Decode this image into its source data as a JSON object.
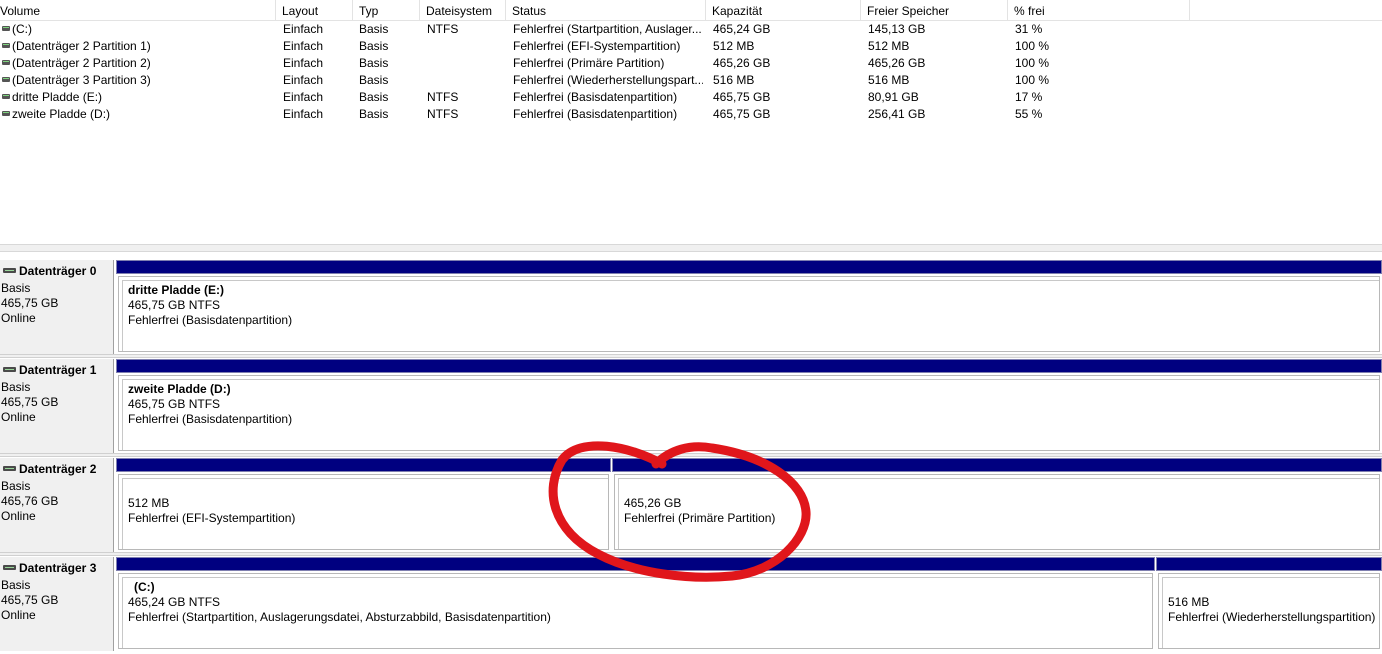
{
  "volume_list": {
    "columns": [
      "Volume",
      "Layout",
      "Typ",
      "Dateisystem",
      "Status",
      "Kapazität",
      "Freier Speicher",
      "% frei"
    ],
    "rows": [
      {
        "volume": " (C:)",
        "layout": "Einfach",
        "typ": "Basis",
        "dateisystem": "NTFS",
        "status": "Fehlerfrei (Startpartition, Auslager...",
        "kapazitaet": "465,24 GB",
        "frei": "145,13 GB",
        "prozent": "31 %"
      },
      {
        "volume": "(Datenträger 2 Partition 1)",
        "layout": "Einfach",
        "typ": "Basis",
        "dateisystem": "",
        "status": "Fehlerfrei (EFI-Systempartition)",
        "kapazitaet": "512 MB",
        "frei": "512 MB",
        "prozent": "100 %"
      },
      {
        "volume": "(Datenträger 2 Partition 2)",
        "layout": "Einfach",
        "typ": "Basis",
        "dateisystem": "",
        "status": "Fehlerfrei (Primäre Partition)",
        "kapazitaet": "465,26 GB",
        "frei": "465,26 GB",
        "prozent": "100 %"
      },
      {
        "volume": "(Datenträger 3 Partition 3)",
        "layout": "Einfach",
        "typ": "Basis",
        "dateisystem": "",
        "status": "Fehlerfrei (Wiederherstellungspart...",
        "kapazitaet": "516 MB",
        "frei": "516 MB",
        "prozent": "100 %"
      },
      {
        "volume": "dritte Pladde (E:)",
        "layout": "Einfach",
        "typ": "Basis",
        "dateisystem": "NTFS",
        "status": "Fehlerfrei (Basisdatenpartition)",
        "kapazitaet": "465,75 GB",
        "frei": "80,91 GB",
        "prozent": "17 %"
      },
      {
        "volume": "zweite Pladde (D:)",
        "layout": "Einfach",
        "typ": "Basis",
        "dateisystem": "NTFS",
        "status": "Fehlerfrei (Basisdatenpartition)",
        "kapazitaet": "465,75 GB",
        "frei": "256,41 GB",
        "prozent": "55 %"
      }
    ]
  },
  "disks": [
    {
      "name": "Datenträger 0",
      "type": "Basis",
      "size": "465,75 GB",
      "state": "Online",
      "partitions": [
        {
          "title": "dritte Pladde  (E:)",
          "line1": "465,75 GB NTFS",
          "line2": "Fehlerfrei (Basisdatenpartition)"
        }
      ]
    },
    {
      "name": "Datenträger 1",
      "type": "Basis",
      "size": "465,75 GB",
      "state": "Online",
      "partitions": [
        {
          "title": "zweite Pladde  (D:)",
          "line1": "465,75 GB NTFS",
          "line2": "Fehlerfrei (Basisdatenpartition)"
        }
      ]
    },
    {
      "name": "Datenträger 2",
      "type": "Basis",
      "size": "465,76 GB",
      "state": "Online",
      "partitions": [
        {
          "title": "",
          "line1": "512 MB",
          "line2": "Fehlerfrei (EFI-Systempartition)"
        },
        {
          "title": "",
          "line1": "465,26 GB",
          "line2": "Fehlerfrei (Primäre Partition)"
        }
      ]
    },
    {
      "name": "Datenträger 3",
      "type": "Basis",
      "size": "465,75 GB",
      "state": "Online",
      "partitions": [
        {
          "title": "(C:)",
          "line1": "465,24 GB NTFS",
          "line2": "Fehlerfrei (Startpartition, Auslagerungsdatei, Absturzabbild, Basisdatenpartition)"
        },
        {
          "title": "",
          "line1": "516 MB",
          "line2": "Fehlerfrei (Wiederherstellungspartition)"
        }
      ]
    }
  ],
  "colors": {
    "partition_bar": "#000080",
    "annotation": "#e0161b",
    "label_bg": "#f0f0f0"
  }
}
